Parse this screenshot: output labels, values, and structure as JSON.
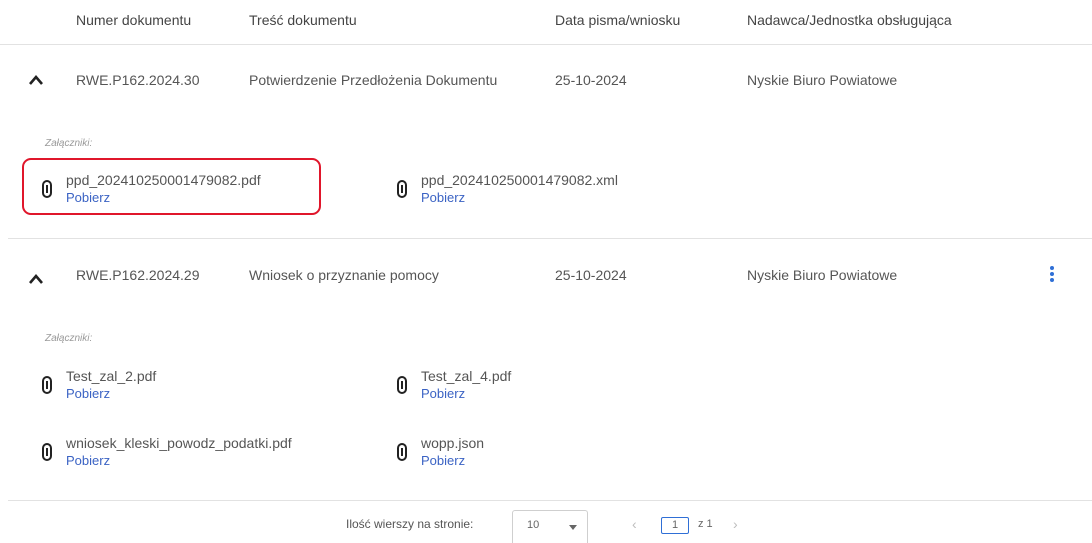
{
  "columns": {
    "number": "Numer dokumentu",
    "content": "Treść dokumentu",
    "date": "Data pisma/wniosku",
    "sender": "Nadawca/Jednostka obsługująca"
  },
  "rows": [
    {
      "number": "RWE.P162.2024.30",
      "content": "Potwierdzenie Przedłożenia Dokumentu",
      "date": "25-10-2024",
      "sender": "Nyskie Biuro Powiatowe",
      "attachments_label": "Załączniki:",
      "attachments": [
        {
          "name": "ppd_20241025000147908​2.pdf",
          "download": "Pobierz"
        },
        {
          "name": "ppd_202410250001479082.xml",
          "download": "Pobierz"
        }
      ]
    },
    {
      "number": "RWE.P162.2024.29",
      "content": "Wniosek o przyznanie pomocy",
      "date": "25-10-2024",
      "sender": "Nyskie Biuro Powiatowe",
      "attachments_label": "Załączniki:",
      "attachments": [
        {
          "name": "Test_zal_2.pdf",
          "download": "Pobierz"
        },
        {
          "name": "Test_zal_4.pdf",
          "download": "Pobierz"
        },
        {
          "name": "wniosek_kleski_powodz_podatki.pdf",
          "download": "Pobierz"
        },
        {
          "name": "wopp.json",
          "download": "Pobierz"
        }
      ]
    }
  ],
  "footer": {
    "rows_per_page_label": "Ilość wierszy na stronie:",
    "rows_per_page_value": "10",
    "current_page": "1",
    "of_pages": "z 1"
  },
  "colors": {
    "link": "#3b63c4",
    "highlight": "#e0162b",
    "accent": "#2f6fd6"
  }
}
